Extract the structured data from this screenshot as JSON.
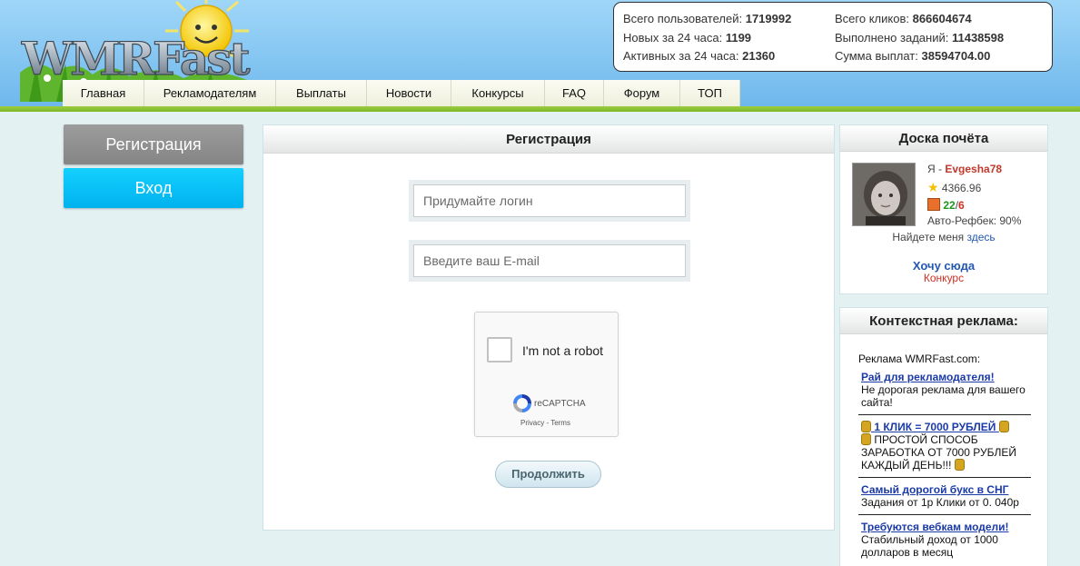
{
  "logo": {
    "text": "WMRFast"
  },
  "stats": {
    "total_users_label": "Всего пользователей:",
    "total_users": "1719992",
    "new_24h_label": "Новых за 24 часа:",
    "new_24h": "1199",
    "active_24h_label": "Активных за 24 часа:",
    "active_24h": "21360",
    "total_clicks_label": "Всего кликов:",
    "total_clicks": "866604674",
    "tasks_done_label": "Выполнено заданий:",
    "tasks_done": "11438598",
    "payouts_label": "Сумма выплат:",
    "payouts": "38594704.00"
  },
  "menu": [
    {
      "label": "Главная"
    },
    {
      "label": "Рекламодателям"
    },
    {
      "label": "Выплаты"
    },
    {
      "label": "Новости"
    },
    {
      "label": "Конкурсы"
    },
    {
      "label": "FAQ"
    },
    {
      "label": "Форум"
    },
    {
      "label": "ТОП"
    }
  ],
  "left": {
    "register_label": "Регистрация",
    "login_label": "Вход"
  },
  "form": {
    "title": "Регистрация",
    "login_placeholder": "Придумайте логин",
    "email_placeholder": "Введите ваш E-mail",
    "captcha_label": "I'm not a robot",
    "captcha_brand": "reCAPTCHA",
    "captcha_links": "Privacy - Terms",
    "continue_label": "Продолжить"
  },
  "honor": {
    "title": "Доска почёта",
    "me_prefix": "Я - ",
    "user_name": "Evgesha78",
    "rating": "4366.96",
    "refs_green": "22",
    "refs_sep": "/",
    "refs_red": "6",
    "auto_refback": "Авто-Рефбек: 90%",
    "find_me_text": "Найдете меня ",
    "find_me_link": "здесь",
    "want_here": "Хочу сюда",
    "contest": "Конкурс"
  },
  "ads": {
    "title": "Контекстная реклама:",
    "site_label": "Реклама WMRFast.com:",
    "items": [
      {
        "title": "Рай для рекламодателя!",
        "text": "Не дорогая реклама для вашего сайта!"
      },
      {
        "title": "1 КЛИК = 7000 РУБЛЕЙ",
        "text": "ПРОСТОЙ СПОСОБ ЗАРАБОТКА ОТ 7000 РУБЛЕЙ КАЖДЫЙ ДЕНЬ!!!"
      },
      {
        "title": "Самый дорогой букс в СНГ",
        "text": "Задания от 1р Клики от 0. 040р"
      },
      {
        "title": "Требуются вебкам модели!",
        "text": "Стабильный доход от 1000 долларов в месяц"
      }
    ]
  },
  "colors": {
    "accent_cyan": "#00b2ee",
    "user_name_red": "#c0392b",
    "link_blue": "#2358b0",
    "header_green": "#7cb82a"
  }
}
